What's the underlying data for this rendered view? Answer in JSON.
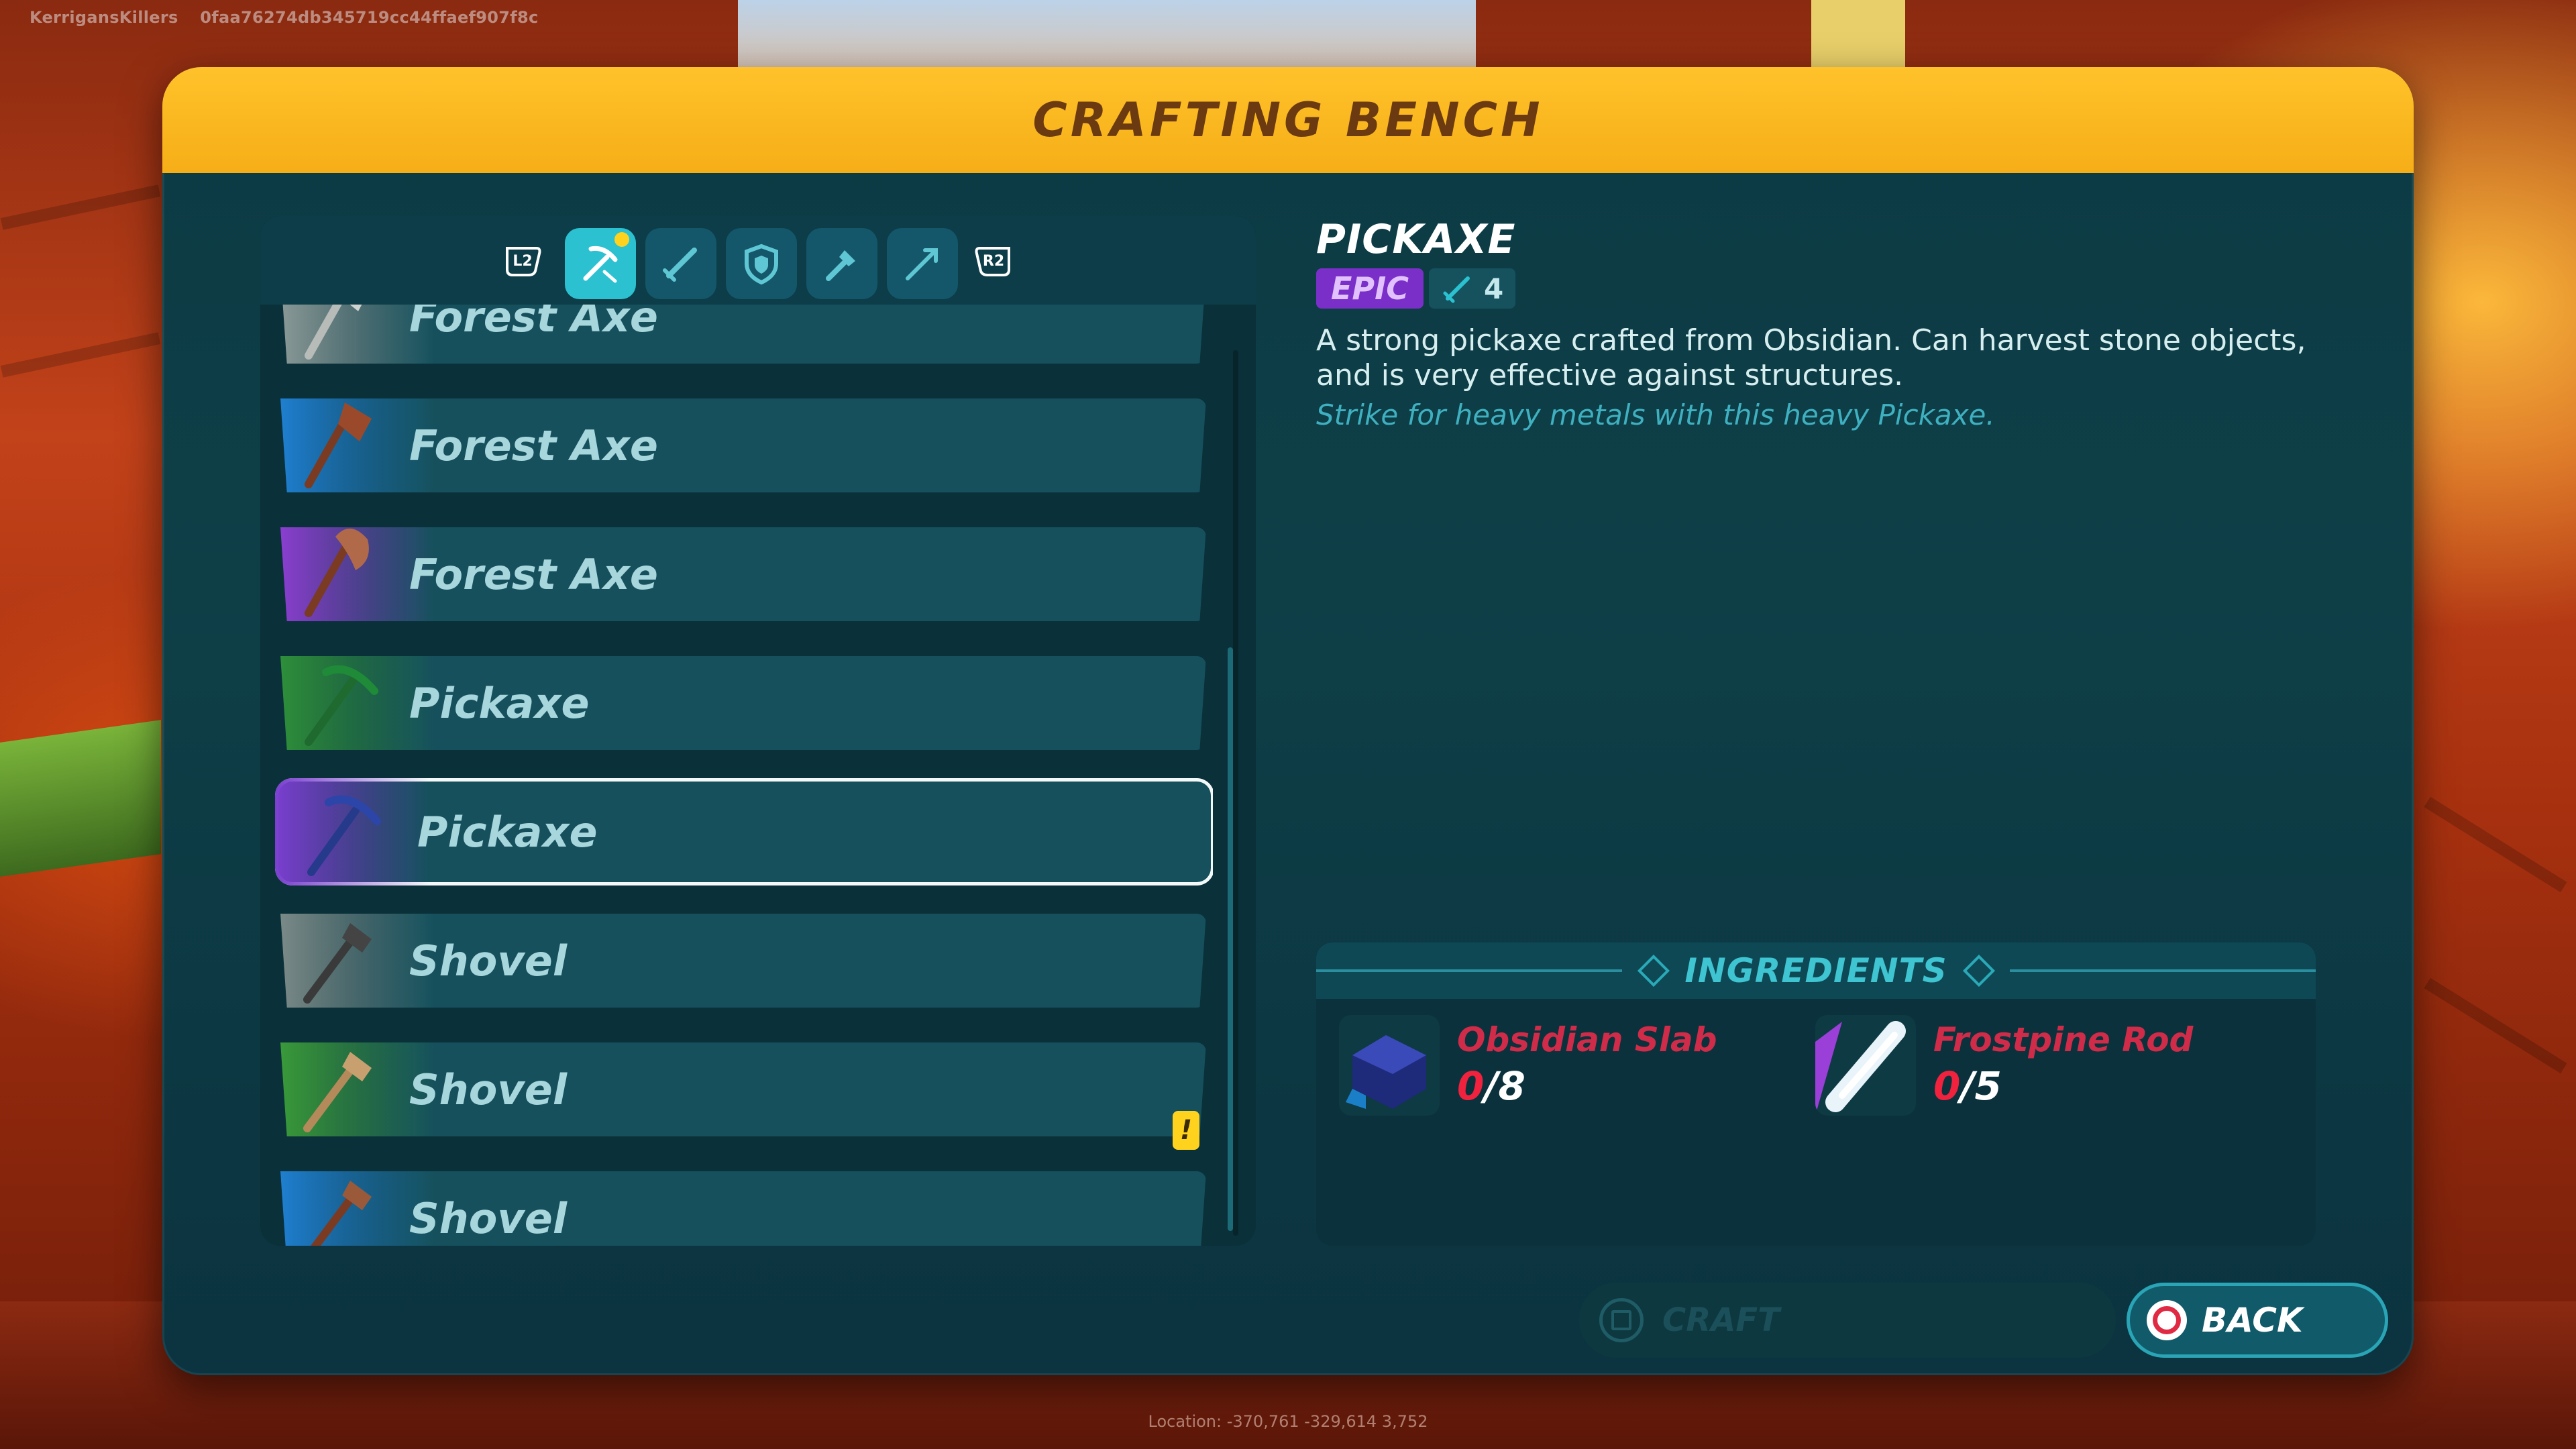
{
  "hud": {
    "player_name": "KerrigansKillers",
    "session_id": "0faa76274db345719cc44ffaef907f8c",
    "location": "Location: -370,761  -329,614  3,752"
  },
  "window": {
    "title": "CRAFTING BENCH"
  },
  "tabs": {
    "left_shoulder": "L2",
    "right_shoulder": "R2",
    "items": [
      {
        "name": "tools",
        "icon": "pickaxe-icon",
        "active": true,
        "has_new": true
      },
      {
        "name": "weapons",
        "icon": "sword-icon",
        "active": false
      },
      {
        "name": "armor",
        "icon": "shield-icon",
        "active": false
      },
      {
        "name": "utility",
        "icon": "torch-icon",
        "active": false
      },
      {
        "name": "ranged",
        "icon": "arrow-icon",
        "active": false
      }
    ]
  },
  "recipes": [
    {
      "label": "Forest Axe",
      "rarity": "common",
      "icon": "axe-icon",
      "rarity_color": "#8a9a98"
    },
    {
      "label": "Forest Axe",
      "rarity": "rare",
      "icon": "axe-icon",
      "rarity_color": "#1f7fd0"
    },
    {
      "label": "Forest Axe",
      "rarity": "epic",
      "icon": "axe-icon",
      "rarity_color": "#8a3fcf"
    },
    {
      "label": "Pickaxe",
      "rarity": "uncommon",
      "icon": "pickaxe-icon",
      "rarity_color": "#2e8f3a"
    },
    {
      "label": "Pickaxe",
      "rarity": "epic",
      "icon": "pickaxe-icon",
      "rarity_color": "#7a3fd0",
      "selected": true
    },
    {
      "label": "Shovel",
      "rarity": "common",
      "icon": "shovel-icon",
      "rarity_color": "#7a8a88"
    },
    {
      "label": "Shovel",
      "rarity": "uncommon",
      "icon": "shovel-icon",
      "rarity_color": "#3a9a3a"
    },
    {
      "label": "Shovel",
      "rarity": "rare",
      "icon": "shovel-icon",
      "rarity_color": "#1f7fd0"
    }
  ],
  "new_badge": "!",
  "detail": {
    "title": "PICKAXE",
    "rarity": "EPIC",
    "tier": "4",
    "description": "A strong pickaxe crafted from Obsidian. Can harvest stone objects, and is very effective against structures.",
    "flavor": "Strike for heavy metals with this heavy Pickaxe."
  },
  "ingredients": {
    "title": "INGREDIENTS",
    "items": [
      {
        "name": "Obsidian Slab",
        "have": "0",
        "need": "/8",
        "icon": "obsidian-slab-icon"
      },
      {
        "name": "Frostpine Rod",
        "have": "0",
        "need": "/5",
        "icon": "frostpine-rod-icon"
      }
    ]
  },
  "actions": {
    "craft": "CRAFT",
    "back": "BACK"
  },
  "colors": {
    "title_bar": "#ffc22a",
    "epic": "#7a2fc9",
    "missing": "#f0223e",
    "accent": "#2bc1d0"
  }
}
